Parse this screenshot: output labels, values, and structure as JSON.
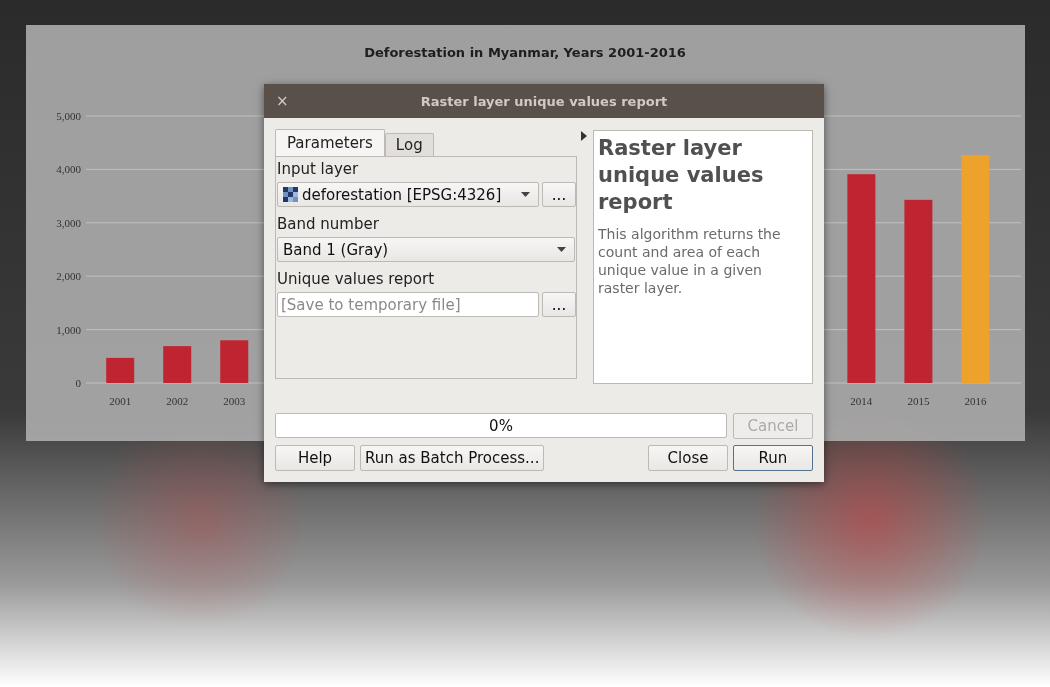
{
  "chart": {
    "chart_data": {
      "type": "bar",
      "title": "Deforestation in Myanmar, Years 2001-2016",
      "x": [
        2001,
        2002,
        2003,
        2014,
        2015,
        2016
      ],
      "xticks": [
        2001,
        2002,
        2003,
        2014,
        2015,
        2016
      ],
      "xlim": [
        2000.4,
        2016.8
      ],
      "ylim": [
        0,
        5000
      ],
      "grid": true,
      "yticks": [
        {
          "value": 0,
          "label": "0"
        },
        {
          "value": 1000,
          "label": "1,000"
        },
        {
          "value": 2000,
          "label": "2,000"
        },
        {
          "value": 3000,
          "label": "3,000"
        },
        {
          "value": 4000,
          "label": "4,000"
        },
        {
          "value": 5000,
          "label": "5,000"
        }
      ],
      "series": [
        {
          "color": "#bf2530",
          "values": [
            470,
            690,
            800,
            3910,
            3430,
            null
          ]
        },
        {
          "color": "#eda22b",
          "values": [
            null,
            null,
            null,
            null,
            null,
            4270
          ]
        }
      ]
    }
  },
  "dialog": {
    "title": "Raster layer unique values report",
    "close": "×",
    "tabs": [
      {
        "label": "Parameters",
        "selected": true
      },
      {
        "label": "Log",
        "selected": false
      }
    ],
    "fields": [
      {
        "kind": "layer",
        "label": "Input layer",
        "value": "deforestation [EPSG:4326]",
        "button": "..."
      },
      {
        "kind": "combo",
        "label": "Band number",
        "value": "Band 1 (Gray)"
      },
      {
        "kind": "file",
        "label": "Unique values report",
        "placeholder": "[Save to temporary file]",
        "button": "..."
      }
    ],
    "help": {
      "title": "Raster layer unique values report",
      "text": "This algorithm returns the count and area of each unique value in a given raster layer."
    },
    "progress": {
      "level": 0,
      "text": "0%"
    },
    "cancel": {
      "label": "Cancel",
      "disabled": true
    },
    "left_buttons": [
      {
        "label": "Help",
        "default": false
      },
      {
        "label": "Run as Batch Process...",
        "default": false
      }
    ],
    "right_buttons": [
      {
        "label": "Close",
        "default": false
      },
      {
        "label": "Run",
        "default": true
      }
    ]
  }
}
